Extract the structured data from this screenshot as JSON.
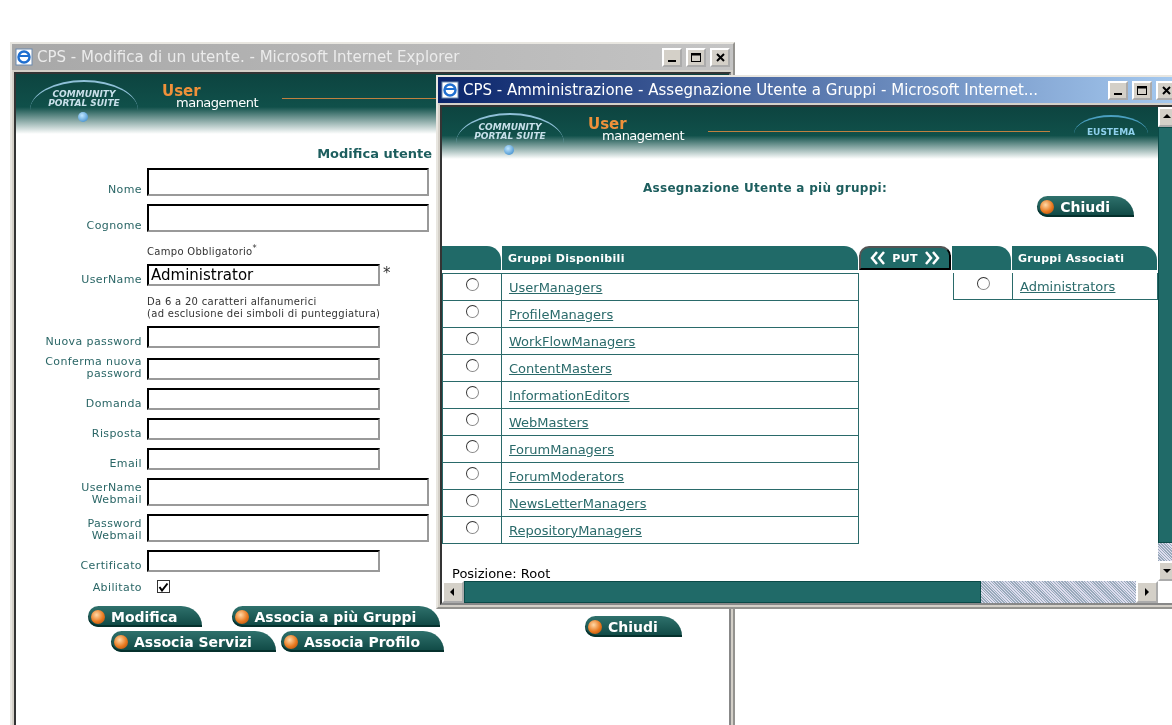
{
  "windows": [
    {
      "kind": "edit_user",
      "title": "CPS - Modifica di un utente. - Microsoft Internet Explorer",
      "active": false,
      "banner": {
        "logo": [
          "COMMUNITY",
          "PORTAL SUITE"
        ],
        "app_name": "User",
        "app_subtitle": "management"
      },
      "heading": "Modifica utente",
      "form": [
        {
          "kind": "widefield",
          "label": "Nome"
        },
        {
          "kind": "widefield",
          "label": "Cognome"
        },
        {
          "kind": "note",
          "lines": [
            "Campo Obbligatorio$^{*}$"
          ]
        },
        {
          "kind": "field",
          "label": "UserName",
          "value": "Administrator",
          "mark": "*"
        },
        {
          "kind": "note",
          "lines": [
            "Da 6 a 20 caratteri alfanumerici",
            "(ad esclusione dei simboli di punteggiatura)"
          ]
        },
        {
          "kind": "field",
          "label": "Nuova password"
        },
        {
          "kind": "field",
          "label": "Conferma nuova\npassword"
        },
        {
          "kind": "field",
          "label": "Domanda"
        },
        {
          "kind": "field",
          "label": "Risposta"
        },
        {
          "kind": "field",
          "label": "Email"
        },
        {
          "kind": "widefield",
          "label": "UserName\nWebmail"
        },
        {
          "kind": "widefield",
          "label": "Password\nWebmail"
        },
        {
          "kind": "field",
          "label": "Certificato"
        },
        {
          "kind": "checkbox",
          "label": "Abilitato",
          "checked": true
        }
      ],
      "action_rows": [
        [
          "Modifica",
          "Associa a più Gruppi"
        ],
        [
          "Associa Servizi",
          "Associa Profilo"
        ]
      ],
      "close_button": "Chiudi"
    },
    {
      "kind": "assign_groups",
      "title": "CPS - Amministrazione - Assegnazione Utente a Gruppi - Microsoft Internet...",
      "active": true,
      "banner": {
        "logo": [
          "COMMUNITY",
          "PORTAL SUITE"
        ],
        "app_name": "User",
        "app_subtitle": "management",
        "brand": "EUSTEMA"
      },
      "heading": "Assegnazione Utente a più gruppi:",
      "close_button": "Chiudi",
      "available": {
        "header": "Gruppi Disponibili",
        "groups": [
          {
            "name": "UserManagers",
            "selected": false
          },
          {
            "name": "ProfileManagers",
            "selected": false
          },
          {
            "name": "WorkFlowManagers",
            "selected": false
          },
          {
            "name": "ContentMasters",
            "selected": false
          },
          {
            "name": "InformationEditors",
            "selected": false
          },
          {
            "name": "WebMasters",
            "selected": false
          },
          {
            "name": "ForumManagers",
            "selected": false
          },
          {
            "name": "ForumModerators",
            "selected": false
          },
          {
            "name": "NewsLetterManagers",
            "selected": false
          },
          {
            "name": "RepositoryManagers",
            "selected": false
          }
        ]
      },
      "transfer": {
        "label": "PUT"
      },
      "associated": {
        "header": "Gruppi Associati",
        "groups": [
          {
            "name": "Administrators",
            "selected": false
          }
        ]
      },
      "position": "Posizione: Root"
    }
  ]
}
